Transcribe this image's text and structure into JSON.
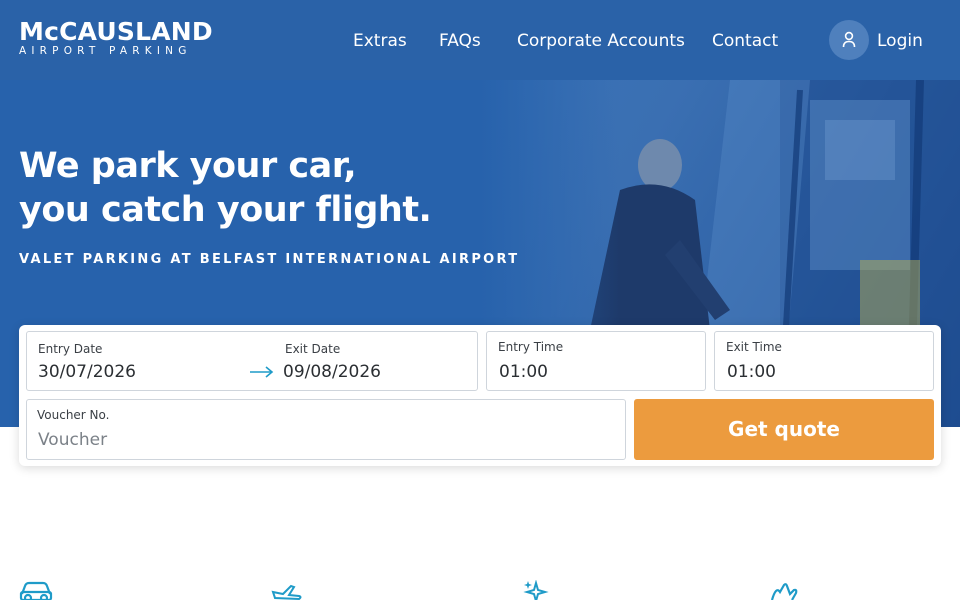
{
  "header": {
    "logo_main": "McCAUSLAND",
    "logo_sub": "AIRPORT PARKING",
    "nav": [
      "Extras",
      "FAQs",
      "Corporate Accounts",
      "Contact"
    ],
    "login_label": "Login",
    "login_icon": "user-icon"
  },
  "hero": {
    "headline_line1": "We park your car,",
    "headline_line2": "you catch your flight.",
    "subline": "VALET PARKING AT BELFAST INTERNATIONAL AIRPORT"
  },
  "booking": {
    "entry_date": {
      "label": "Entry Date",
      "value": "30/07/2026"
    },
    "exit_date": {
      "label": "Exit Date",
      "value": "09/08/2026"
    },
    "entry_time": {
      "label": "Entry Time",
      "value": "01:00"
    },
    "exit_time": {
      "label": "Exit Time",
      "value": "01:00"
    },
    "voucher": {
      "label": "Voucher No.",
      "placeholder": "Voucher",
      "value": ""
    },
    "submit_label": "Get quote",
    "arrow_icon": "arrow-right-icon"
  },
  "features": {
    "icons": [
      "car-icon",
      "plane-icon",
      "sparkle-icon",
      "hand-icon"
    ]
  },
  "colors": {
    "brand_blue": "#2762ac",
    "accent_orange": "#ec9b3e",
    "icon_teal": "#1f9bc8"
  }
}
